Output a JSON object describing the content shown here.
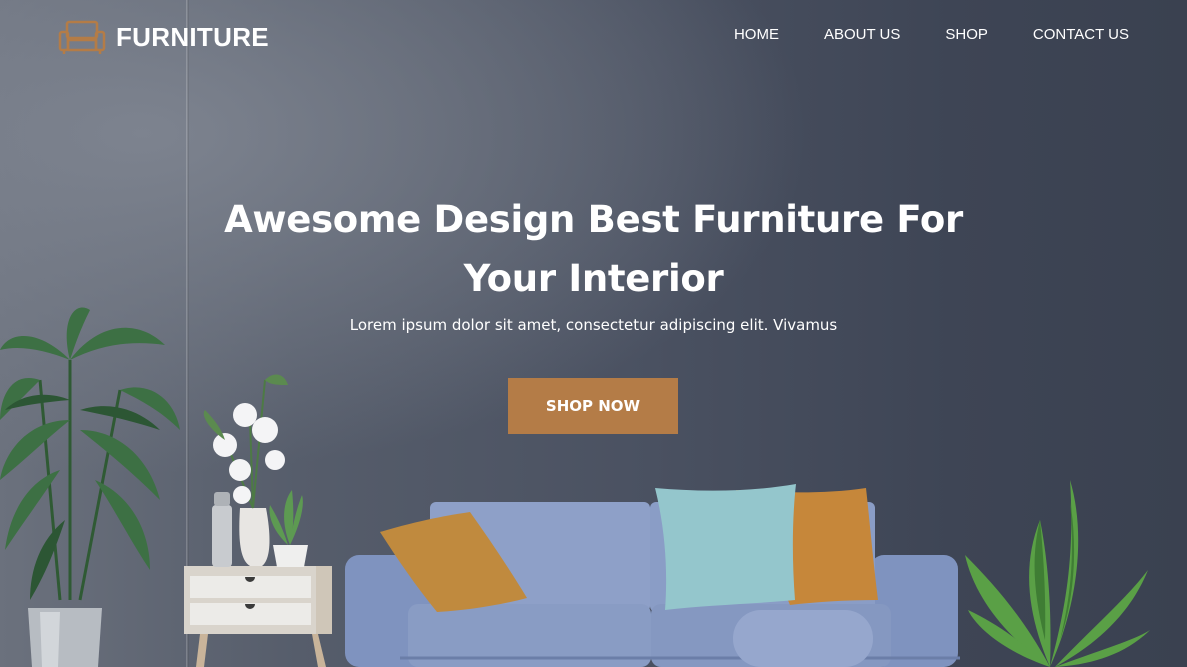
{
  "brand": {
    "name": "FURNITURE",
    "icon": "sofa-icon",
    "icon_color": "#b47c47"
  },
  "nav": {
    "items": [
      {
        "label": "HOME"
      },
      {
        "label": "ABOUT US"
      },
      {
        "label": "SHOP"
      },
      {
        "label": "CONTACT US"
      }
    ]
  },
  "hero": {
    "title_line1": "Awesome Design Best Furniture For",
    "title_line2": "Your Interior",
    "subtitle": "Lorem ipsum dolor sit amet, consectetur adipiscing elit. Vivamus",
    "cta_label": "SHOP NOW",
    "cta_color": "#b47c47"
  }
}
